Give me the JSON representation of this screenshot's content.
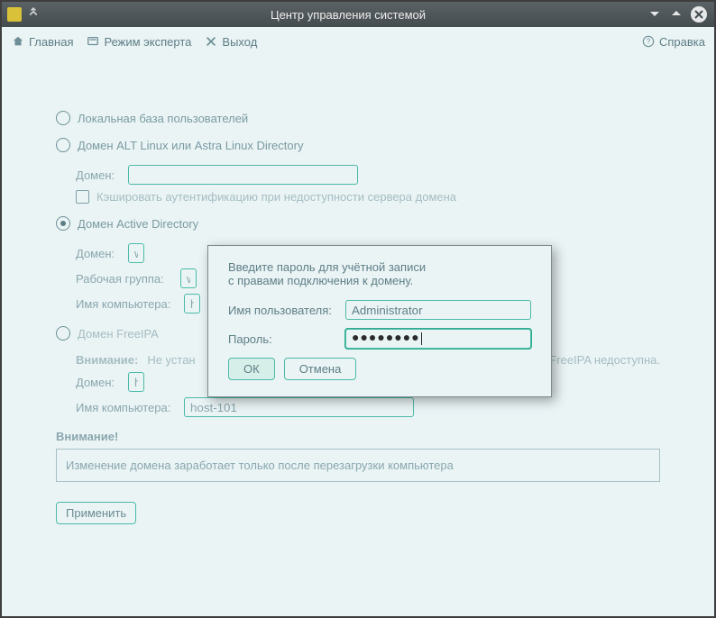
{
  "titlebar": {
    "title": "Центр управления системой"
  },
  "toolbar": {
    "home": "Главная",
    "expert": "Режим эксперта",
    "exit": "Выход",
    "help": "Справка"
  },
  "radios": {
    "local": "Локальная база пользователей",
    "altlinux": "Домен ALT Linux или Astra Linux Directory",
    "ad": "Домен Active Directory",
    "freeipa": "Домен FreeIPA"
  },
  "alt": {
    "domain_label": "Домен:",
    "domain_value": "",
    "cache_label": "Кэшировать аутентификацию при недоступности сервера домена"
  },
  "ad": {
    "domain_label": "Домен:",
    "domain_value": "w",
    "wg_label": "Рабочая группа:",
    "wg_value": "w",
    "host_label": "Имя компьютера:",
    "host_value": "h"
  },
  "ipa": {
    "warn_label": "Внимание:",
    "warn_text": "Не установлен пакет клиента FreeIPA. Аутентификация в FreeIPA недоступна.",
    "warn_text_tail": "е FreeIPA недоступна.",
    "domain_label": "Домен:",
    "domain_value": "h",
    "host_label": "Имя компьютера:",
    "host_value": "host-101"
  },
  "notice": {
    "title": "Внимание!",
    "body": "Изменение домена заработает только после перезагрузки компьютера"
  },
  "apply": "Применить",
  "modal": {
    "line1": "Введите пароль для учётной записи",
    "line2": "с правами подключения к домену.",
    "user_label": "Имя пользователя:",
    "user_value": "Administrator",
    "pass_label": "Пароль:",
    "pass_mask": "●●●●●●●●",
    "ok": "ОК",
    "cancel": "Отмена"
  }
}
